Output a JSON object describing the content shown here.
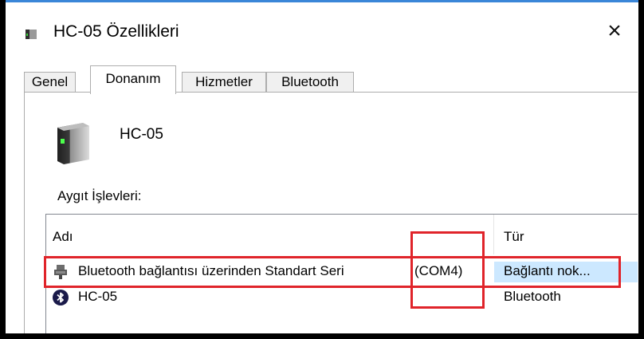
{
  "window": {
    "title": "HC-05 Özellikleri",
    "close_glyph": "×"
  },
  "tabs": [
    {
      "label": "Genel",
      "active": false
    },
    {
      "label": "Donanım",
      "active": true
    },
    {
      "label": "Hizmetler",
      "active": false
    },
    {
      "label": "Bluetooth",
      "active": false
    }
  ],
  "device": {
    "name": "HC-05",
    "icon": "device-icon"
  },
  "functions": {
    "label": "Aygıt İşlevleri:",
    "columns": {
      "name": "Adı",
      "type": "Tür"
    },
    "rows": [
      {
        "name": "Bluetooth bağlantısı üzerinden Standart Seri",
        "port": "(COM4)",
        "type": "Bağlantı nok...",
        "icon": "serial-port-icon",
        "selected": true
      },
      {
        "name": "HC-05",
        "port": "",
        "type": "Bluetooth",
        "icon": "bluetooth-icon",
        "selected": false
      }
    ]
  },
  "colors": {
    "highlight": "#e0242a",
    "selection": "#cce8ff",
    "accent": "#3a86d8"
  }
}
